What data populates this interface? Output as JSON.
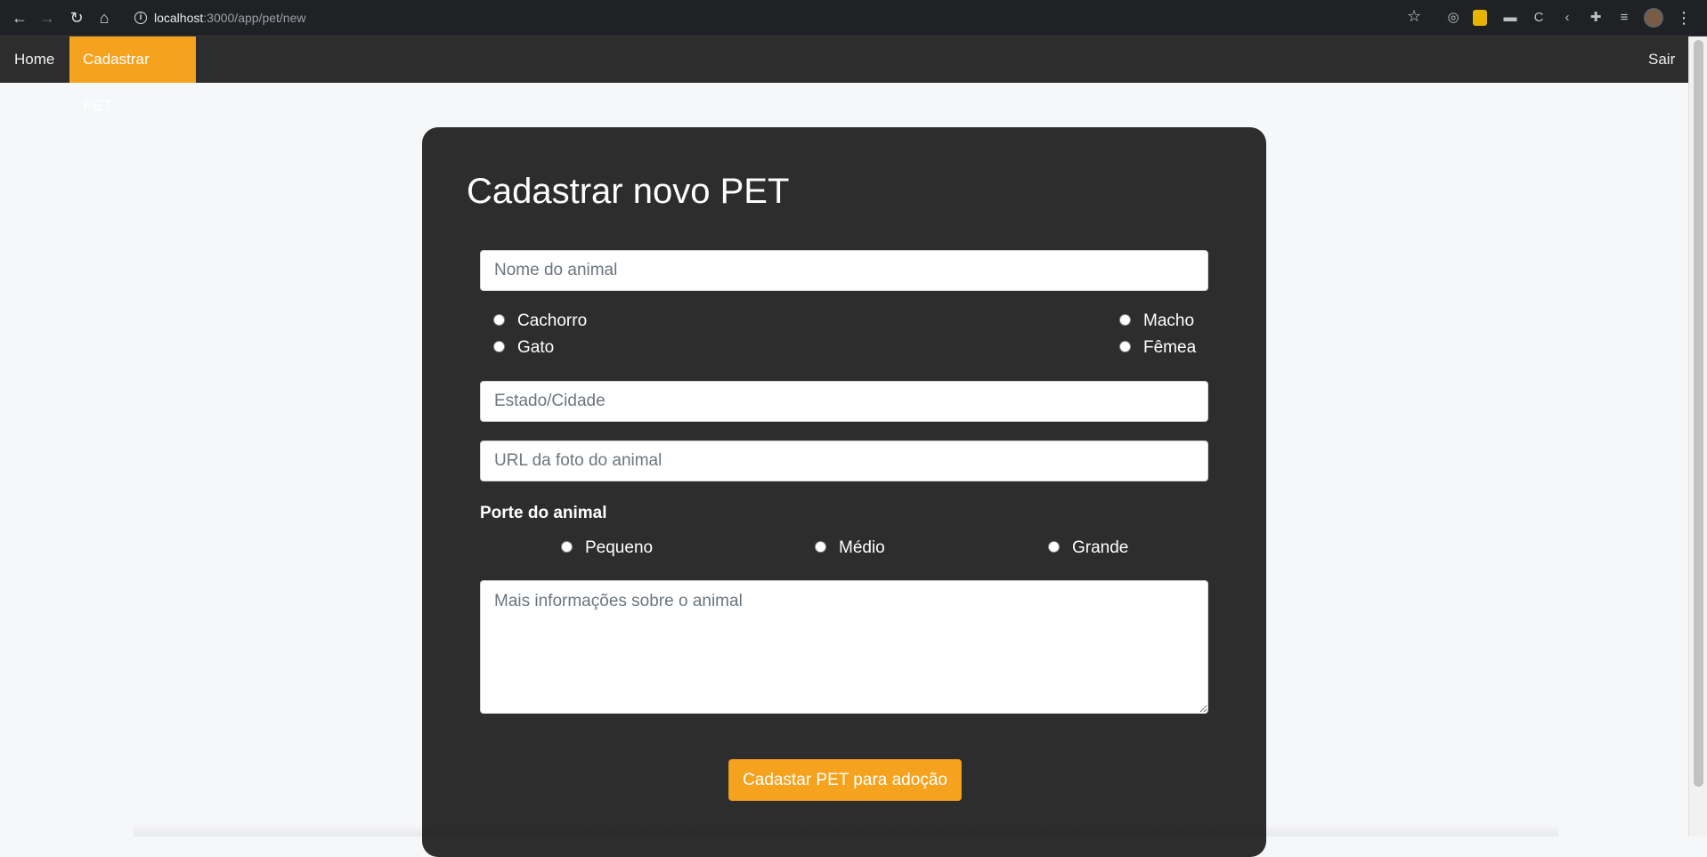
{
  "browser": {
    "url_host": "localhost",
    "url_path": ":3000/app/pet/new",
    "back_icon": "←",
    "forward_icon": "→",
    "reload_icon": "↻",
    "home_icon": "⌂",
    "star_icon": "☆",
    "menu_icon": "⋮"
  },
  "nav": {
    "home": "Home",
    "register_pet": "Cadastrar PET",
    "logout": "Sair",
    "active_color": "#f5a21f"
  },
  "form": {
    "title": "Cadastrar novo PET",
    "name_placeholder": "Nome do animal",
    "species": [
      "Cachorro",
      "Gato"
    ],
    "sex": [
      "Macho",
      "Fêmea"
    ],
    "location_placeholder": "Estado/Cidade",
    "photo_placeholder": "URL da foto do animal",
    "size_label": "Porte do animal",
    "sizes": [
      "Pequeno",
      "Médio",
      "Grande"
    ],
    "info_placeholder": "Mais informações sobre o animal",
    "submit_label": "Cadastar PET para adoção"
  },
  "colors": {
    "accent": "#f5a21f",
    "card_bg": "#2d2d2d",
    "page_bg": "#f6f7f9"
  }
}
